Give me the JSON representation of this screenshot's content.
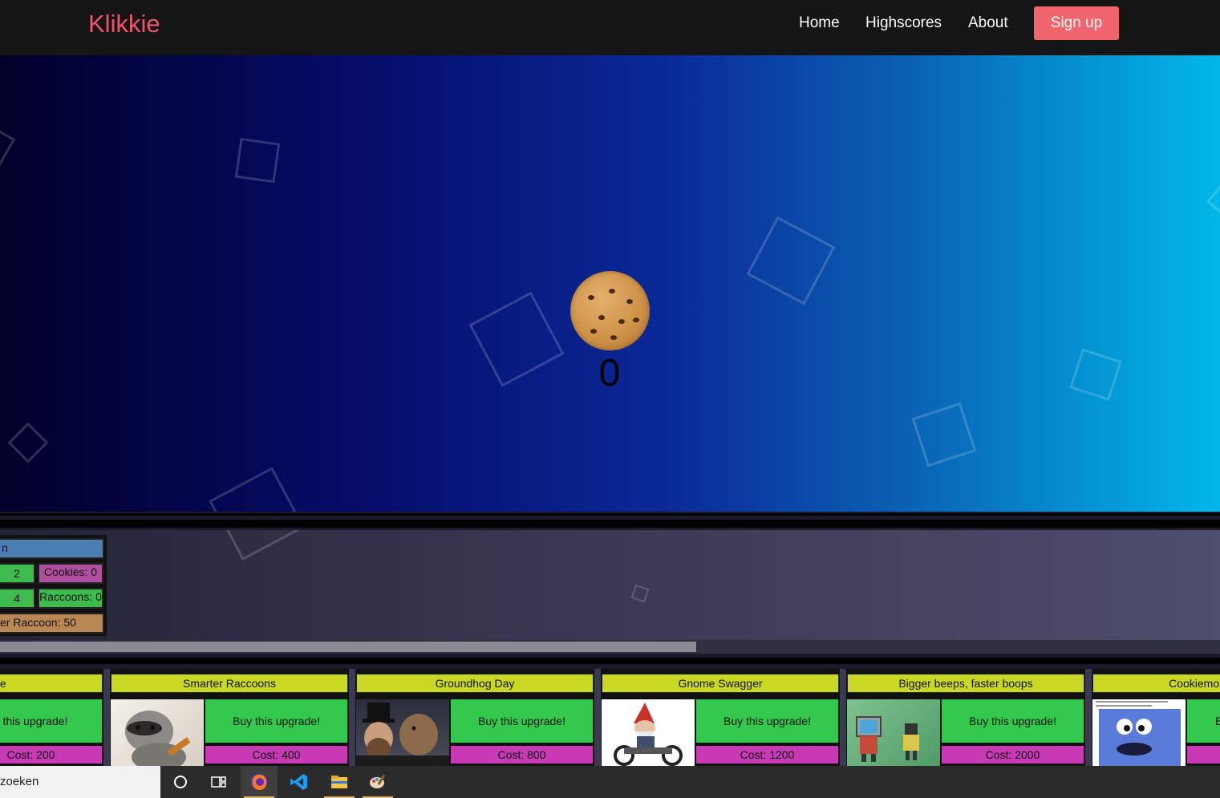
{
  "navbar": {
    "brand": "Klikkie",
    "links": [
      "Home",
      "Highscores",
      "About"
    ],
    "signup": "Sign up",
    "colors": {
      "brand": "#f0556b",
      "signup_bg": "#f0656b"
    }
  },
  "game": {
    "counter": "0",
    "cookie_icon": "cookie-icon"
  },
  "stats": {
    "title_partial": "n",
    "left_values": [
      "2",
      "4"
    ],
    "cookies_label": "Cookies: 0",
    "raccoons_label": "Raccoons: 0",
    "raccoon_cost_partial": "er Raccoon: 50"
  },
  "upgrades": [
    {
      "title": "e Cookie",
      "buy": "y this upgrade!",
      "cost": "Cost: 200",
      "image": "cookie-upgrade-image"
    },
    {
      "title": "Smarter Raccoons",
      "buy": "Buy this upgrade!",
      "cost": "Cost: 400",
      "image": "raccoon-image"
    },
    {
      "title": "Groundhog Day",
      "buy": "Buy this upgrade!",
      "cost": "Cost: 800",
      "image": "groundhog-image"
    },
    {
      "title": "Gnome Swagger",
      "buy": "Buy this upgrade!",
      "cost": "Cost: 1200",
      "image": "gnome-image"
    },
    {
      "title": "Bigger beeps, faster boops",
      "buy": "Buy this upgrade!",
      "cost": "Cost: 2000",
      "image": "robot-image"
    },
    {
      "title": "Cookiemonster e",
      "buy": "B",
      "cost": "",
      "image": "cookiemonster-image"
    }
  ],
  "taskbar": {
    "search_text": "zoeken",
    "apps": [
      "cortana-icon",
      "task-view-icon",
      "firefox-icon",
      "vscode-icon",
      "file-explorer-icon",
      "paint-icon"
    ]
  }
}
